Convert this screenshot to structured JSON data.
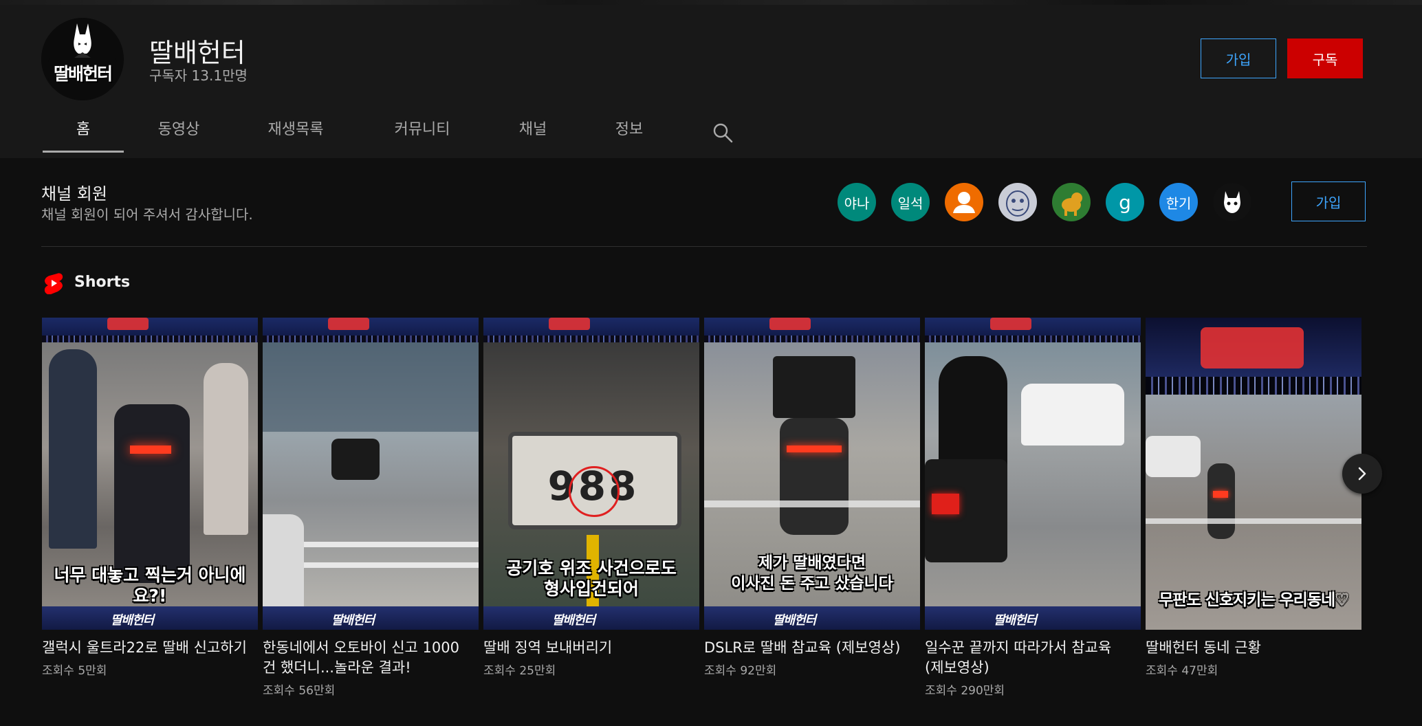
{
  "channel": {
    "name": "딸배헌터",
    "subscribers": "구독자 13.1만명",
    "avatar_text": "딸배헌터",
    "join_label": "가입",
    "subscribe_label": "구독"
  },
  "tabs": [
    {
      "label": "홈",
      "active": true
    },
    {
      "label": "동영상"
    },
    {
      "label": "재생목록"
    },
    {
      "label": "커뮤니티"
    },
    {
      "label": "채널"
    },
    {
      "label": "정보"
    }
  ],
  "members": {
    "title": "채널 회원",
    "subtitle": "채널 회원이 되어 주셔서 감사합니다.",
    "join_label": "가입",
    "avatars": [
      {
        "text": "야나",
        "color": "#00897b"
      },
      {
        "text": "일석",
        "color": "#00897b"
      },
      {
        "text": "",
        "color": "#ef6c00",
        "icon": "person-icon"
      },
      {
        "text": "",
        "color": "#c9ccd6",
        "icon": "character-icon"
      },
      {
        "text": "",
        "color": "#2e7d32",
        "icon": "dog-icon"
      },
      {
        "text": "g",
        "color": "#0097a7"
      },
      {
        "text": "한기",
        "color": "#1e88e5"
      },
      {
        "text": "",
        "color": "#111111",
        "icon": "mascot-icon"
      }
    ]
  },
  "shorts": {
    "title": "Shorts",
    "items": [
      {
        "title": "갤럭시 울트라22로 딸배 신고하기",
        "views": "조회수 5만회",
        "caption": "너무 대놓고 찍는거 아니에요?!",
        "bottom": "딸배헌터"
      },
      {
        "title": "한동네에서 오토바이 신고 1000건 했더니...놀라운 결과!",
        "views": "조회수 56만회",
        "caption": "",
        "bottom": "딸배헌터"
      },
      {
        "title": "딸배 징역 보내버리기",
        "views": "조회수 25만회",
        "caption": "공기호 위조 사건으로도\n형사입건되어",
        "plate": "988",
        "bottom": "딸배헌터"
      },
      {
        "title": "DSLR로 딸배 참교육 (제보영상)",
        "views": "조회수 92만회",
        "caption": "제가 딸배였다면\n이사진 돈 주고 샀습니다",
        "bottom": "딸배헌터"
      },
      {
        "title": "일수꾼 끝까지 따라가서 참교육 (제보영상)",
        "views": "조회수 290만회",
        "caption": "",
        "bottom": "딸배헌터"
      },
      {
        "title": "딸배헌터 동네 근황",
        "views": "조회수 47만회",
        "caption": "무판도 신호지키는 우리동네♡",
        "bottom": ""
      }
    ]
  },
  "colors": {
    "accent_blue": "#3ea6ff",
    "subscribe_red": "#cc0000",
    "shorts_red": "#ff0000"
  }
}
